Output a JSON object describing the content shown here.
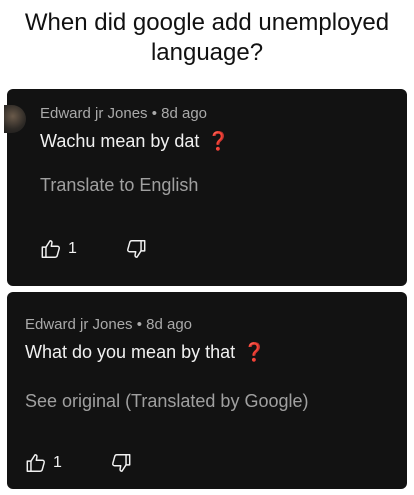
{
  "headline": {
    "line1": "When did google add unemployed",
    "line2": "language?"
  },
  "comments": [
    {
      "author_time": "Edward jr Jones • 8d ago",
      "text": "Wachu mean by dat",
      "emoji": "❓",
      "translate_link": "Translate to English",
      "like_count": "1",
      "icons": {
        "like": "thumbs-up-icon",
        "dislike": "thumbs-down-icon"
      }
    },
    {
      "author_time": "Edward jr Jones • 8d ago",
      "text": "What do you mean by that",
      "emoji": "❓",
      "translate_link": "See original (Translated by Google)",
      "like_count": "1",
      "icons": {
        "like": "thumbs-up-icon",
        "dislike": "thumbs-down-icon"
      }
    }
  ],
  "colors": {
    "card_bg": "#121212",
    "text": "#f1f1f1",
    "meta": "#aaaaaa",
    "link": "#a0a0a0",
    "emoji_red": "#e53935"
  }
}
